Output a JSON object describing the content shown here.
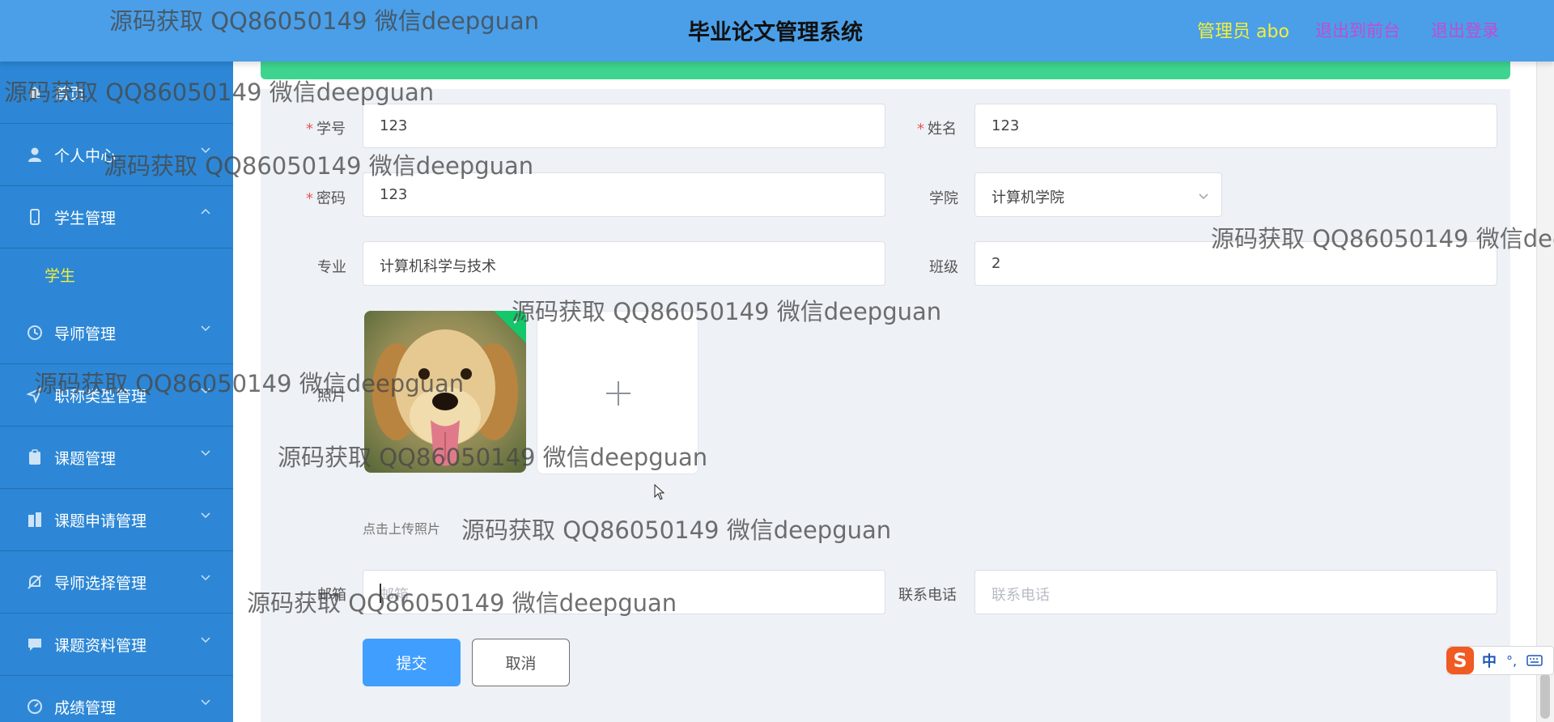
{
  "header": {
    "title": "毕业论文管理系统",
    "admin": "管理员 abo",
    "exit_front": "退出到前台",
    "logout": "退出登录"
  },
  "sidebar": {
    "items": [
      {
        "label": "首页",
        "icon": "home-icon"
      },
      {
        "label": "个人中心",
        "icon": "user-icon"
      },
      {
        "label": "学生管理",
        "icon": "phone-icon",
        "expanded": true
      },
      {
        "label": "导师管理",
        "icon": "clock-icon"
      },
      {
        "label": "职称类型管理",
        "icon": "send-icon"
      },
      {
        "label": "课题管理",
        "icon": "clipboard-icon"
      },
      {
        "label": "课题申请管理",
        "icon": "building-icon"
      },
      {
        "label": "导师选择管理",
        "icon": "bell-off-icon"
      },
      {
        "label": "课题资料管理",
        "icon": "chat-icon"
      },
      {
        "label": "成绩管理",
        "icon": "gauge-icon"
      }
    ],
    "subitems": [
      {
        "label": "学生"
      }
    ]
  },
  "form": {
    "student_id": {
      "label": "学号",
      "value": "123",
      "required": true
    },
    "name": {
      "label": "姓名",
      "value": "123",
      "required": true
    },
    "password": {
      "label": "密码",
      "value": "123",
      "required": true
    },
    "college": {
      "label": "学院",
      "value": "计算机学院"
    },
    "major": {
      "label": "专业",
      "value": "计算机科学与技术"
    },
    "class": {
      "label": "班级",
      "value": "2"
    },
    "photo": {
      "label": "照片",
      "tip": "点击上传照片"
    },
    "email": {
      "label": "邮箱",
      "placeholder": "邮箱"
    },
    "phone": {
      "label": "联系电话",
      "placeholder": "联系电话"
    },
    "submit": "提交",
    "cancel": "取消"
  },
  "watermark": "源码获取 QQ86050149 微信deepguan",
  "ime": {
    "zh": "中",
    "punct": "°,"
  },
  "colors": {
    "header": "#4a9fe8",
    "sidebar": "#2d87d6",
    "accent_yellow": "#f4ef3a",
    "link_purple": "#c34bd3",
    "green_bar": "#3ed48f",
    "primary": "#409eff",
    "required": "#e85656"
  }
}
